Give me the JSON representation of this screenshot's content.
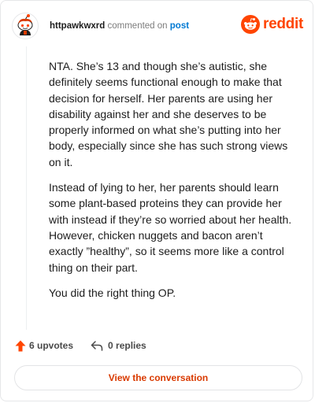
{
  "header": {
    "username": "httpawkwxrd",
    "action_text": "commented on",
    "post_link": "post",
    "brand_name": "reddit",
    "avatar_icon": "reddit-snoo-avatar-icon",
    "brand_icon": "reddit-snoo-logo-icon"
  },
  "comment": {
    "paragraphs": [
      "NTA. She’s 13 and though she’s autistic, she definitely seems functional enough to make that decision for herself. Her parents are using her disability against her and she deserves to be properly informed on what she’s putting into her body, especially since she has such strong views on it.",
      "Instead of lying to her, her parents should learn some plant-based proteins they can provide her with instead if they’re so worried about her health. However, chicken nuggets and bacon aren’t exactly ”healthy”, so it seems more like a control thing on their part.",
      "You did the right thing OP."
    ]
  },
  "actions": {
    "upvotes": "6 upvotes",
    "replies": "0 replies",
    "upvote_icon": "upvote-arrow-icon",
    "reply_icon": "reply-arrow-icon"
  },
  "footer": {
    "view_button": "View the conversation"
  },
  "colors": {
    "brand": "#ff4500",
    "link": "#0079d3",
    "button_text": "#d93a00",
    "text": "#1c1c1c",
    "muted": "#7c7c7c"
  }
}
